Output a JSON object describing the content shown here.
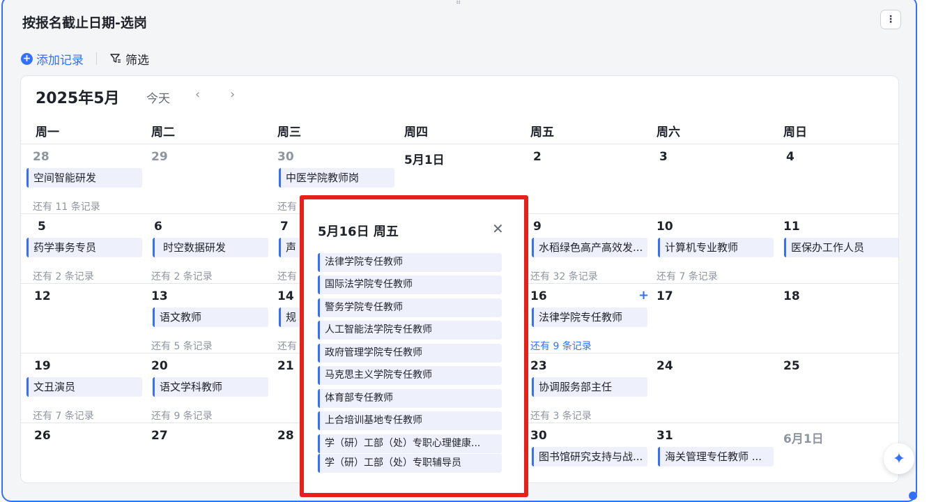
{
  "card": {
    "title": "按报名截止日期-选岗",
    "more_icon": "⋮"
  },
  "toolbar": {
    "add_label": "添加记录",
    "filter_label": "筛选"
  },
  "calendar": {
    "month_label": "2025年5月",
    "today_label": "今天",
    "weekdays": [
      "周一",
      "周二",
      "周三",
      "周四",
      "周五",
      "周六",
      "周日"
    ],
    "rows": [
      {
        "days": [
          "28",
          "29",
          "30",
          "5月1日",
          "2",
          "3",
          "4"
        ],
        "events": {
          "mon": "空间智能研发",
          "wed": "中医学院教师岗"
        },
        "more": {
          "mon": "还有 11 条记录",
          "wed": "还有"
        }
      },
      {
        "days": [
          "5",
          "6",
          "7",
          "9",
          "10",
          "11"
        ],
        "events": {
          "mon": "药学事务专员",
          "tue": "时空数据研发",
          "wed": "声",
          "fri": "水稻绿色高产高效发...",
          "sat": "计算机专业教师",
          "sun": "医保办工作人员"
        },
        "more": {
          "mon": "还有 2 条记录",
          "tue": "还有 2 条记录",
          "wed": "还有",
          "fri": "还有 32 条记录",
          "sat": "还有 7 条记录"
        }
      },
      {
        "days": [
          "12",
          "13",
          "14",
          "16",
          "17",
          "18"
        ],
        "events": {
          "tue": "语文教师",
          "wed": "规",
          "fri": "法律学院专任教师"
        },
        "more": {
          "tue": "还有 5 条记录",
          "wed": "还有",
          "fri": "还有 9 条记录"
        }
      },
      {
        "days": [
          "19",
          "20",
          "21",
          "23",
          "24",
          "25"
        ],
        "events": {
          "mon": "文丑演员",
          "tue": "语文学科教师",
          "fri": "协调服务部主任"
        },
        "more": {
          "mon": "还有 7 条记录",
          "tue": "还有 9 条记录",
          "fri": "还有 3 条记录"
        }
      },
      {
        "days": [
          "26",
          "27",
          "28",
          "30",
          "31",
          "6月1日"
        ],
        "events": {
          "fri": "图书馆研究支持与战...",
          "sat": "海关管理专任教师 ..."
        }
      }
    ]
  },
  "popup": {
    "title": "5月16日 周五",
    "items": [
      "法律学院专任教师",
      "国际法学院专任教师",
      "警务学院专任教师",
      "人工智能法学院专任教师",
      "政府管理学院专任教师",
      "马克思主义学院专任教师",
      "体育部专任教师",
      "上合培训基地专任教师",
      "学（研）工部（处）专职心理健康...",
      "学（研）工部（处）专职辅导员"
    ]
  },
  "colors": {
    "accent": "#3370ff",
    "highlight_border": "#e8201a",
    "event_bg": "#eef1fc"
  }
}
